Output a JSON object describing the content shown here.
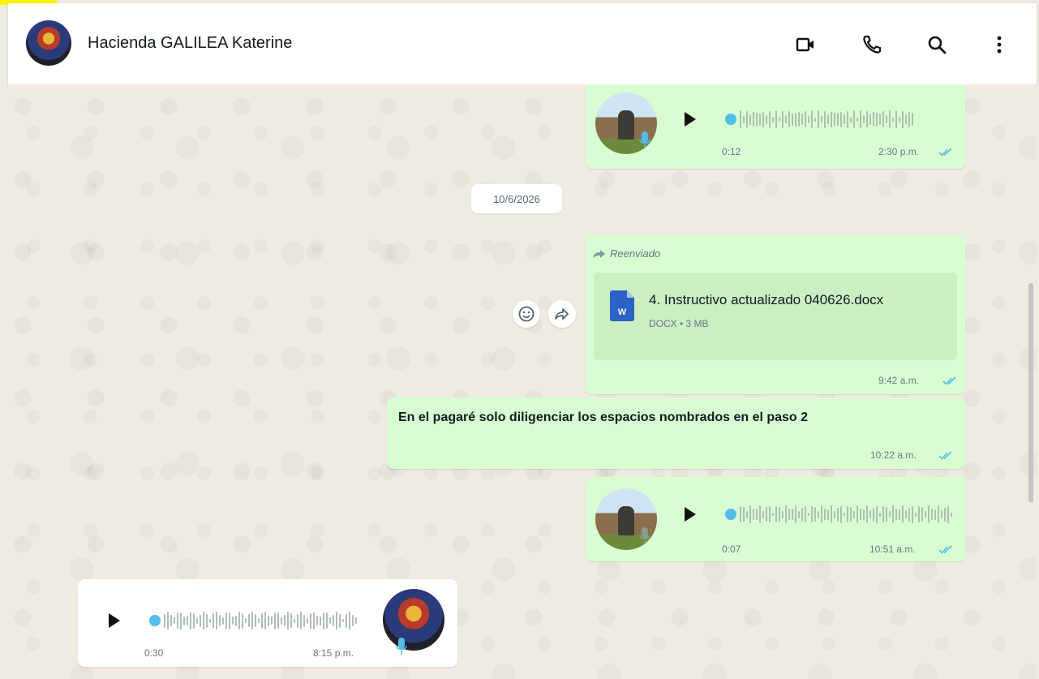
{
  "header": {
    "contact_name": "Hacienda GALILEA Katerine",
    "icons": [
      "video-call-icon",
      "voice-call-icon",
      "search-icon",
      "menu-icon"
    ]
  },
  "messages": {
    "voice1": {
      "duration": "0:12",
      "time": "2:30 p.m."
    },
    "date_separator": "10/6/2026",
    "document": {
      "forwarded_label": "Reenviado",
      "file_name": "4. Instructivo actualizado 040626.docx",
      "file_meta": "DOCX • 3 MB",
      "time": "9:42 a.m."
    },
    "text1": {
      "text": "En el pagaré solo diligenciar los espacios nombrados en el paso 2",
      "time": "10:22 a.m."
    },
    "voice2": {
      "duration": "0:07",
      "time": "10:51 a.m."
    },
    "voice3": {
      "duration": "0:30",
      "time": "8:15 p.m."
    }
  },
  "colors": {
    "outgoing_bubble": "#d9fdd3",
    "incoming_bubble": "#ffffff",
    "tick_blue": "#53bdeb",
    "doc_blue": "#2b62c8"
  }
}
